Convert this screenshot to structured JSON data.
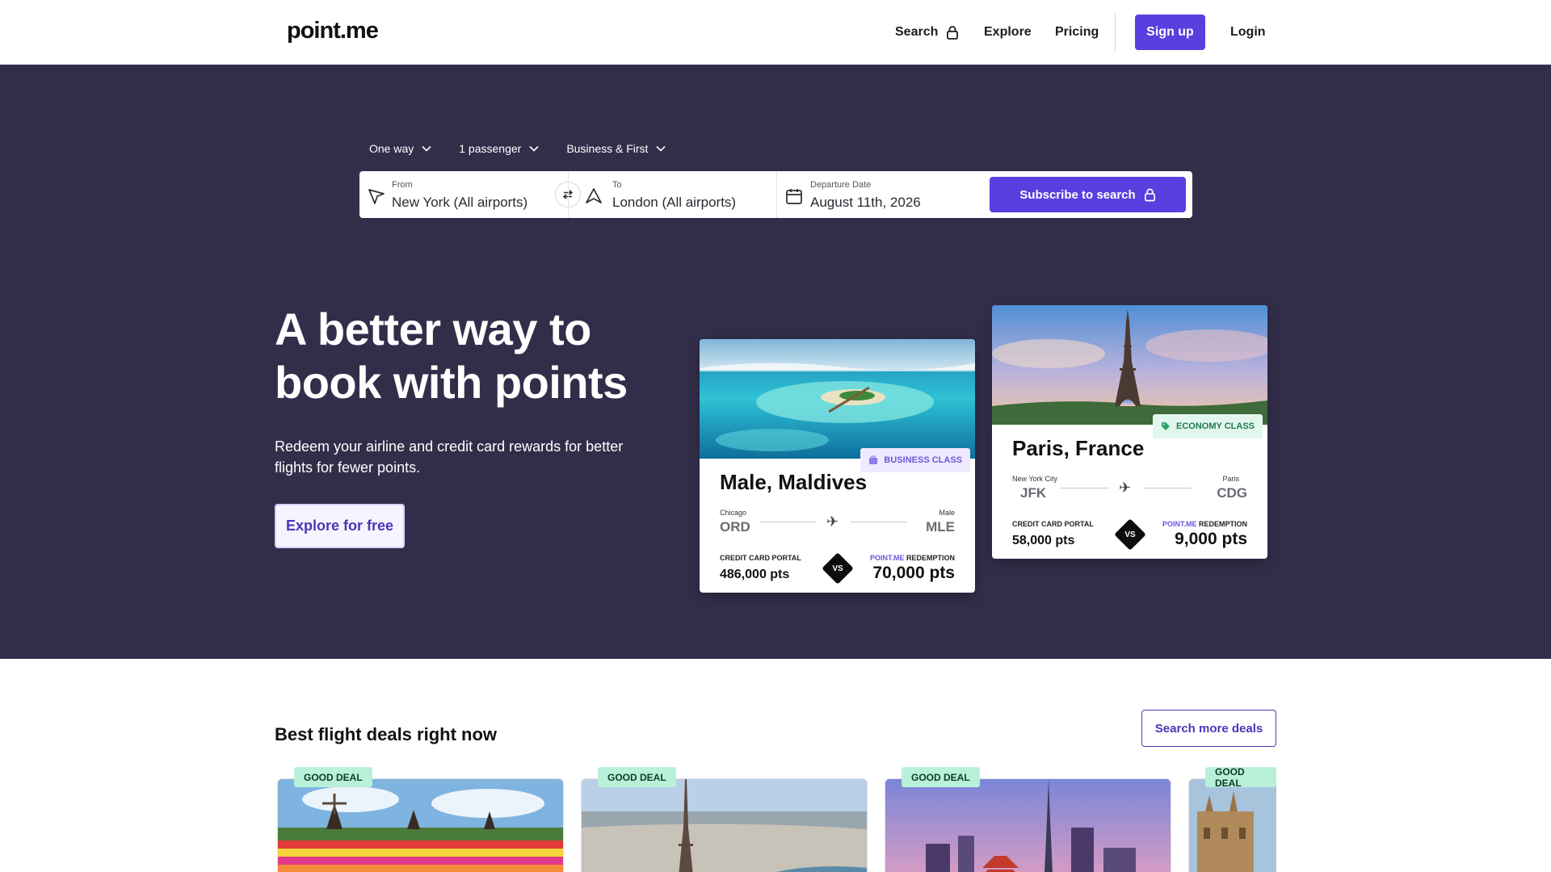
{
  "header": {
    "logo": "point.me",
    "nav": {
      "search": "Search",
      "explore": "Explore",
      "pricing": "Pricing"
    },
    "signup": "Sign up",
    "login": "Login"
  },
  "search": {
    "trip_type": "One way",
    "passengers": "1 passenger",
    "cabin": "Business & First",
    "from_label": "From",
    "from_value": "New York (All airports)",
    "to_label": "To",
    "to_value": "London (All airports)",
    "date_label": "Departure Date",
    "date_value": "August 11th, 2026",
    "submit": "Subscribe to search"
  },
  "hero": {
    "title": "A better way to book with points",
    "subtitle": "Redeem your airline and credit card rewards for better flights for fewer points.",
    "cta": "Explore for free"
  },
  "cards": [
    {
      "name": "Male, Maldives",
      "class": "BUSINESS CLASS",
      "from_city": "Chicago",
      "from_code": "ORD",
      "to_city": "Male",
      "to_code": "MLE",
      "portal_label": "CREDIT CARD PORTAL",
      "portal_value": "486,000 pts",
      "pm_prefix": "POINT.ME",
      "pm_suffix": "REDEMPTION",
      "pm_value": "70,000 pts",
      "vs": "VS"
    },
    {
      "name": "Paris, France",
      "class": "ECONOMY CLASS",
      "from_city": "New York City",
      "from_code": "JFK",
      "to_city": "Paris",
      "to_code": "CDG",
      "portal_label": "CREDIT CARD PORTAL",
      "portal_value": "58,000 pts",
      "pm_prefix": "POINT.ME",
      "pm_suffix": "REDEMPTION",
      "pm_value": "9,000 pts",
      "vs": "VS"
    }
  ],
  "deals": {
    "title": "Best flight deals right now",
    "more": "Search more deals",
    "tag": "GOOD DEAL"
  },
  "colors": {
    "brand": "#5a3ee0",
    "hero_bg": "#322e4a",
    "deal_tag": "#b9f0d9"
  }
}
